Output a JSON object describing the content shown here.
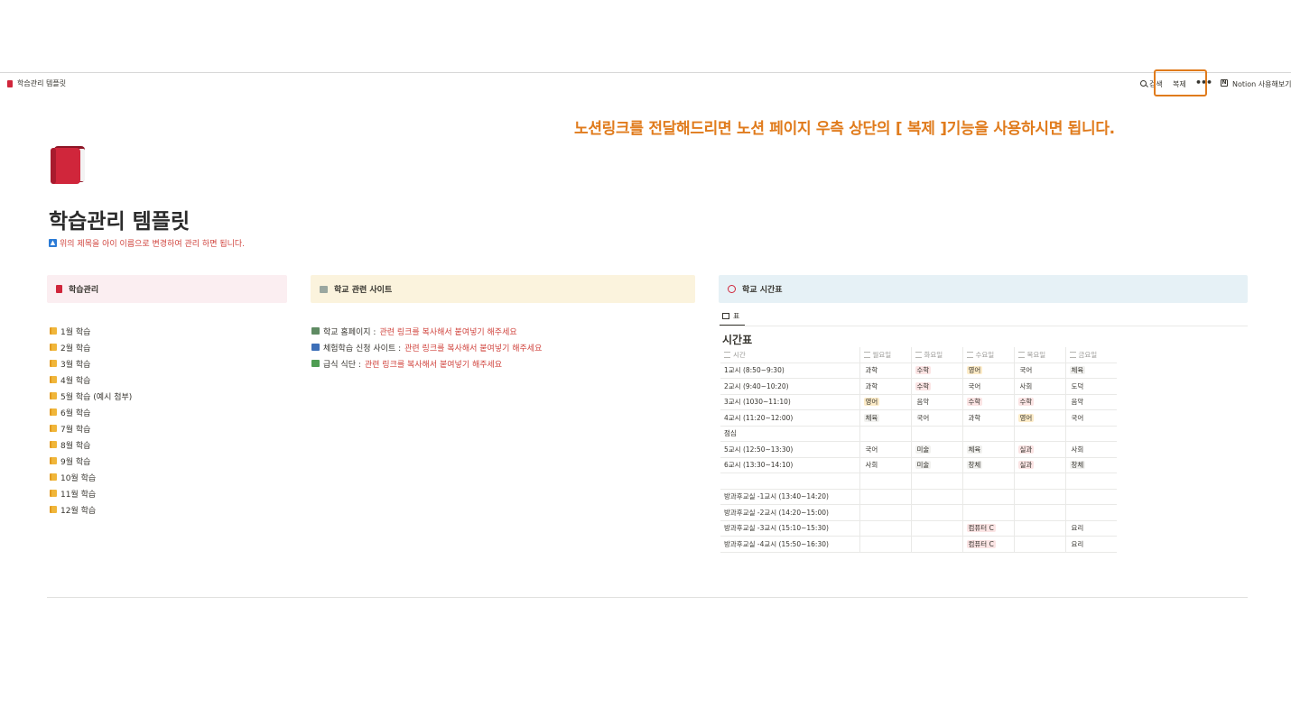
{
  "topbar": {
    "breadcrumb": "학습관리 템플릿",
    "search_label": "검색",
    "duplicate_label": "복제",
    "more_label": "•••",
    "notion_label": "Notion 사용해보기"
  },
  "instruction": "노션링크를 전달해드리면 노션 페이지 우측 상단의 [  복제 ]기능을 사용하시면 됩니다.",
  "page": {
    "title": "학습관리 템플릿",
    "subtitle": "위의 제목을 아이 이름으로 변경하여 관리 하면 됩니다."
  },
  "learning": {
    "heading": "학습관리",
    "items": [
      "1월 학습",
      "2월 학습",
      "3월 학습",
      "4월 학습",
      "5월 학습 (예시 첨부)",
      "6월 학습",
      "7월 학습",
      "8월 학습",
      "9월 학습",
      "10월 학습",
      "11월 학습",
      "12월 학습"
    ]
  },
  "sites": {
    "heading": "학교 관련 사이트",
    "items": [
      {
        "label": "학교 홈페이지 : ",
        "link": "관련 링크를 복사해서 붙여넣기 해주세요",
        "color": "#5f8b63"
      },
      {
        "label": "체험학습 신청 사이트 : ",
        "link": "관련 링크를 복사해서 붙여넣기 해주세요",
        "color": "#3d6fb8"
      },
      {
        "label": "급식 식단 : ",
        "link": "관련 링크를 복사해서 붙여넣기 해주세요",
        "color": "#4f9d53"
      }
    ]
  },
  "timetable": {
    "heading": "학교 시간표",
    "tab_label": "표",
    "db_title": "시간표",
    "columns": [
      "시간",
      "월요일",
      "화요일",
      "수요일",
      "목요일",
      "금요일"
    ],
    "rows": [
      [
        "1교시 (8:50~9:30)",
        "과학",
        "수학",
        "영어",
        "국어",
        "체육"
      ],
      [
        "2교시 (9:40~10:20)",
        "과학",
        "수학",
        "국어",
        "사회",
        "도덕"
      ],
      [
        "3교시 (1030~11:10)",
        "영어",
        "음악",
        "수학",
        "수학",
        "음악"
      ],
      [
        "4교시 (11:20~12:00)",
        "체육",
        "국어",
        "과학",
        "영어",
        "국어"
      ],
      [
        "점심",
        "",
        "",
        "",
        "",
        ""
      ],
      [
        "5교시 (12:50~13:30)",
        "국어",
        "미술",
        "체육",
        "실과",
        "사회"
      ],
      [
        "6교시 (13:30~14:10)",
        "사회",
        "미술",
        "창체",
        "실과",
        "창체"
      ],
      [
        "",
        "",
        "",
        "",
        "",
        ""
      ],
      [
        "방과후교실 -1교시 (13:40~14:20)",
        "",
        "",
        "",
        "",
        ""
      ],
      [
        "방과후교실 -2교시 (14:20~15:00)",
        "",
        "",
        "",
        "",
        ""
      ],
      [
        "방과후교실 -3교시 (15:10~15:30)",
        "",
        "",
        "컴퓨터 C",
        "",
        "요리"
      ],
      [
        "방과후교실 -4교시 (15:50~16:30)",
        "",
        "",
        "컴퓨터 C",
        "",
        "요리"
      ]
    ],
    "tag_colors": {
      "과학": "#ffffff",
      "수학": "#fbe4e4",
      "영어": "#fdecc8",
      "국어": "#ffffff",
      "체육": "#f1f1ef",
      "사회": "#ffffff",
      "도덕": "#ffffff",
      "음악": "#ffffff",
      "미술": "#f1f1ef",
      "창체": "#f1f1ef",
      "실과": "#fbe4e4",
      "컴퓨터 C": "#fbe4e4",
      "요리": "#ffffff"
    }
  },
  "colors": {
    "accent_orange": "#e07b1c",
    "link_red": "#d0443e"
  }
}
